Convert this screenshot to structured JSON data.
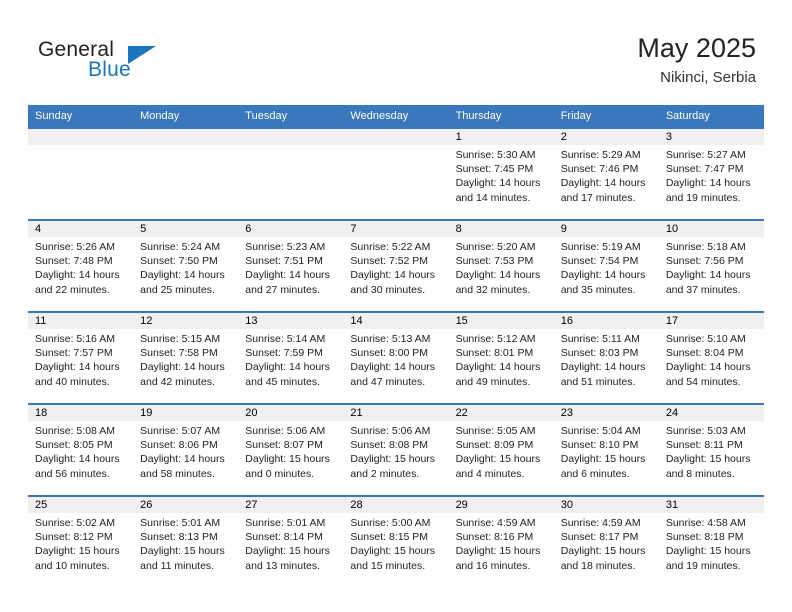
{
  "brand": {
    "name_part1": "General",
    "name_part2": "Blue",
    "logo_icon": "triangle-logo-icon"
  },
  "header": {
    "month_title": "May 2025",
    "location": "Nikinci, Serbia"
  },
  "calendar": {
    "weekdays": [
      "Sunday",
      "Monday",
      "Tuesday",
      "Wednesday",
      "Thursday",
      "Friday",
      "Saturday"
    ],
    "colors": {
      "header_blue": "#3b77bc",
      "day_number_band": "#f0f0f0",
      "brand_blue": "#1b75bb"
    },
    "weeks": [
      [
        {
          "day": "",
          "sunrise": "",
          "sunset": "",
          "daylight_line1": "",
          "daylight_line2": ""
        },
        {
          "day": "",
          "sunrise": "",
          "sunset": "",
          "daylight_line1": "",
          "daylight_line2": ""
        },
        {
          "day": "",
          "sunrise": "",
          "sunset": "",
          "daylight_line1": "",
          "daylight_line2": ""
        },
        {
          "day": "",
          "sunrise": "",
          "sunset": "",
          "daylight_line1": "",
          "daylight_line2": ""
        },
        {
          "day": "1",
          "sunrise": "Sunrise: 5:30 AM",
          "sunset": "Sunset: 7:45 PM",
          "daylight_line1": "Daylight: 14 hours",
          "daylight_line2": "and 14 minutes."
        },
        {
          "day": "2",
          "sunrise": "Sunrise: 5:29 AM",
          "sunset": "Sunset: 7:46 PM",
          "daylight_line1": "Daylight: 14 hours",
          "daylight_line2": "and 17 minutes."
        },
        {
          "day": "3",
          "sunrise": "Sunrise: 5:27 AM",
          "sunset": "Sunset: 7:47 PM",
          "daylight_line1": "Daylight: 14 hours",
          "daylight_line2": "and 19 minutes."
        }
      ],
      [
        {
          "day": "4",
          "sunrise": "Sunrise: 5:26 AM",
          "sunset": "Sunset: 7:48 PM",
          "daylight_line1": "Daylight: 14 hours",
          "daylight_line2": "and 22 minutes."
        },
        {
          "day": "5",
          "sunrise": "Sunrise: 5:24 AM",
          "sunset": "Sunset: 7:50 PM",
          "daylight_line1": "Daylight: 14 hours",
          "daylight_line2": "and 25 minutes."
        },
        {
          "day": "6",
          "sunrise": "Sunrise: 5:23 AM",
          "sunset": "Sunset: 7:51 PM",
          "daylight_line1": "Daylight: 14 hours",
          "daylight_line2": "and 27 minutes."
        },
        {
          "day": "7",
          "sunrise": "Sunrise: 5:22 AM",
          "sunset": "Sunset: 7:52 PM",
          "daylight_line1": "Daylight: 14 hours",
          "daylight_line2": "and 30 minutes."
        },
        {
          "day": "8",
          "sunrise": "Sunrise: 5:20 AM",
          "sunset": "Sunset: 7:53 PM",
          "daylight_line1": "Daylight: 14 hours",
          "daylight_line2": "and 32 minutes."
        },
        {
          "day": "9",
          "sunrise": "Sunrise: 5:19 AM",
          "sunset": "Sunset: 7:54 PM",
          "daylight_line1": "Daylight: 14 hours",
          "daylight_line2": "and 35 minutes."
        },
        {
          "day": "10",
          "sunrise": "Sunrise: 5:18 AM",
          "sunset": "Sunset: 7:56 PM",
          "daylight_line1": "Daylight: 14 hours",
          "daylight_line2": "and 37 minutes."
        }
      ],
      [
        {
          "day": "11",
          "sunrise": "Sunrise: 5:16 AM",
          "sunset": "Sunset: 7:57 PM",
          "daylight_line1": "Daylight: 14 hours",
          "daylight_line2": "and 40 minutes."
        },
        {
          "day": "12",
          "sunrise": "Sunrise: 5:15 AM",
          "sunset": "Sunset: 7:58 PM",
          "daylight_line1": "Daylight: 14 hours",
          "daylight_line2": "and 42 minutes."
        },
        {
          "day": "13",
          "sunrise": "Sunrise: 5:14 AM",
          "sunset": "Sunset: 7:59 PM",
          "daylight_line1": "Daylight: 14 hours",
          "daylight_line2": "and 45 minutes."
        },
        {
          "day": "14",
          "sunrise": "Sunrise: 5:13 AM",
          "sunset": "Sunset: 8:00 PM",
          "daylight_line1": "Daylight: 14 hours",
          "daylight_line2": "and 47 minutes."
        },
        {
          "day": "15",
          "sunrise": "Sunrise: 5:12 AM",
          "sunset": "Sunset: 8:01 PM",
          "daylight_line1": "Daylight: 14 hours",
          "daylight_line2": "and 49 minutes."
        },
        {
          "day": "16",
          "sunrise": "Sunrise: 5:11 AM",
          "sunset": "Sunset: 8:03 PM",
          "daylight_line1": "Daylight: 14 hours",
          "daylight_line2": "and 51 minutes."
        },
        {
          "day": "17",
          "sunrise": "Sunrise: 5:10 AM",
          "sunset": "Sunset: 8:04 PM",
          "daylight_line1": "Daylight: 14 hours",
          "daylight_line2": "and 54 minutes."
        }
      ],
      [
        {
          "day": "18",
          "sunrise": "Sunrise: 5:08 AM",
          "sunset": "Sunset: 8:05 PM",
          "daylight_line1": "Daylight: 14 hours",
          "daylight_line2": "and 56 minutes."
        },
        {
          "day": "19",
          "sunrise": "Sunrise: 5:07 AM",
          "sunset": "Sunset: 8:06 PM",
          "daylight_line1": "Daylight: 14 hours",
          "daylight_line2": "and 58 minutes."
        },
        {
          "day": "20",
          "sunrise": "Sunrise: 5:06 AM",
          "sunset": "Sunset: 8:07 PM",
          "daylight_line1": "Daylight: 15 hours",
          "daylight_line2": "and 0 minutes."
        },
        {
          "day": "21",
          "sunrise": "Sunrise: 5:06 AM",
          "sunset": "Sunset: 8:08 PM",
          "daylight_line1": "Daylight: 15 hours",
          "daylight_line2": "and 2 minutes."
        },
        {
          "day": "22",
          "sunrise": "Sunrise: 5:05 AM",
          "sunset": "Sunset: 8:09 PM",
          "daylight_line1": "Daylight: 15 hours",
          "daylight_line2": "and 4 minutes."
        },
        {
          "day": "23",
          "sunrise": "Sunrise: 5:04 AM",
          "sunset": "Sunset: 8:10 PM",
          "daylight_line1": "Daylight: 15 hours",
          "daylight_line2": "and 6 minutes."
        },
        {
          "day": "24",
          "sunrise": "Sunrise: 5:03 AM",
          "sunset": "Sunset: 8:11 PM",
          "daylight_line1": "Daylight: 15 hours",
          "daylight_line2": "and 8 minutes."
        }
      ],
      [
        {
          "day": "25",
          "sunrise": "Sunrise: 5:02 AM",
          "sunset": "Sunset: 8:12 PM",
          "daylight_line1": "Daylight: 15 hours",
          "daylight_line2": "and 10 minutes."
        },
        {
          "day": "26",
          "sunrise": "Sunrise: 5:01 AM",
          "sunset": "Sunset: 8:13 PM",
          "daylight_line1": "Daylight: 15 hours",
          "daylight_line2": "and 11 minutes."
        },
        {
          "day": "27",
          "sunrise": "Sunrise: 5:01 AM",
          "sunset": "Sunset: 8:14 PM",
          "daylight_line1": "Daylight: 15 hours",
          "daylight_line2": "and 13 minutes."
        },
        {
          "day": "28",
          "sunrise": "Sunrise: 5:00 AM",
          "sunset": "Sunset: 8:15 PM",
          "daylight_line1": "Daylight: 15 hours",
          "daylight_line2": "and 15 minutes."
        },
        {
          "day": "29",
          "sunrise": "Sunrise: 4:59 AM",
          "sunset": "Sunset: 8:16 PM",
          "daylight_line1": "Daylight: 15 hours",
          "daylight_line2": "and 16 minutes."
        },
        {
          "day": "30",
          "sunrise": "Sunrise: 4:59 AM",
          "sunset": "Sunset: 8:17 PM",
          "daylight_line1": "Daylight: 15 hours",
          "daylight_line2": "and 18 minutes."
        },
        {
          "day": "31",
          "sunrise": "Sunrise: 4:58 AM",
          "sunset": "Sunset: 8:18 PM",
          "daylight_line1": "Daylight: 15 hours",
          "daylight_line2": "and 19 minutes."
        }
      ]
    ]
  }
}
